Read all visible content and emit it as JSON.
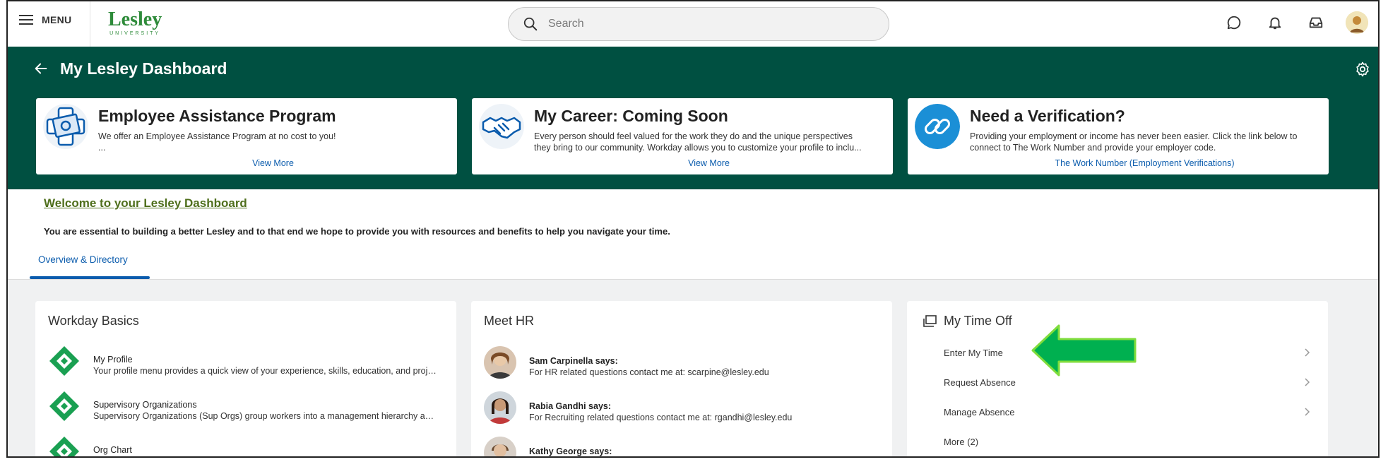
{
  "header": {
    "menu_label": "MENU",
    "logo_word": "Lesley",
    "logo_sub": "UNIVERSITY",
    "search_placeholder": "Search"
  },
  "dashboard": {
    "title": "My Lesley Dashboard",
    "cards": [
      {
        "title": "Employee Assistance Program",
        "desc_line1": "We offer an Employee Assistance Program at no cost to you!",
        "desc_line2": "...",
        "link": "View More"
      },
      {
        "title": "My Career: Coming Soon",
        "desc_line1": "Every person should feel valued for the work they do and the unique perspectives",
        "desc_line2": "they bring to our community. Workday allows you to customize your profile to inclu...",
        "link": "View More"
      },
      {
        "title": "Need a Verification?",
        "desc_line1": "Providing your employment or income has never been easier. Click the link below to",
        "desc_line2": "connect to The Work Number and provide your employer code.",
        "link": "The Work Number (Employment Verifications)"
      }
    ]
  },
  "welcome": {
    "title": "Welcome to your Lesley Dashboard",
    "subtitle": "You are essential to building a better Lesley and to that end we hope to provide you with resources and benefits to help you navigate your time."
  },
  "tabs": [
    {
      "label": "Overview & Directory"
    }
  ],
  "workday_basics": {
    "title": "Workday Basics",
    "items": [
      {
        "name": "My Profile",
        "desc": "Your profile menu provides a quick view of your experience, skills, education, and project..."
      },
      {
        "name": "Supervisory Organizations",
        "desc": "Supervisory Organizations (Sup Orgs) group workers into a management hierarchy and ..."
      },
      {
        "name": "Org Chart",
        "desc": ""
      }
    ]
  },
  "meet_hr": {
    "title": "Meet HR",
    "items": [
      {
        "name": "Sam Carpinella says:",
        "desc": "For HR related questions contact me at: scarpine@lesley.edu"
      },
      {
        "name": "Rabia Gandhi says:",
        "desc": "For Recruiting related questions contact me at: rgandhi@lesley.edu"
      },
      {
        "name": "Kathy George says:",
        "desc": ""
      }
    ]
  },
  "time_off": {
    "title": "My Time Off",
    "items": [
      {
        "label": "Enter My Time"
      },
      {
        "label": "Request Absence"
      },
      {
        "label": "Manage Absence"
      },
      {
        "label": "More (2)"
      }
    ]
  },
  "colors": {
    "brand_green": "#005041",
    "link_blue": "#0b5cad",
    "welcome_green": "#4f6f1c",
    "arrow_green": "#00b050"
  }
}
